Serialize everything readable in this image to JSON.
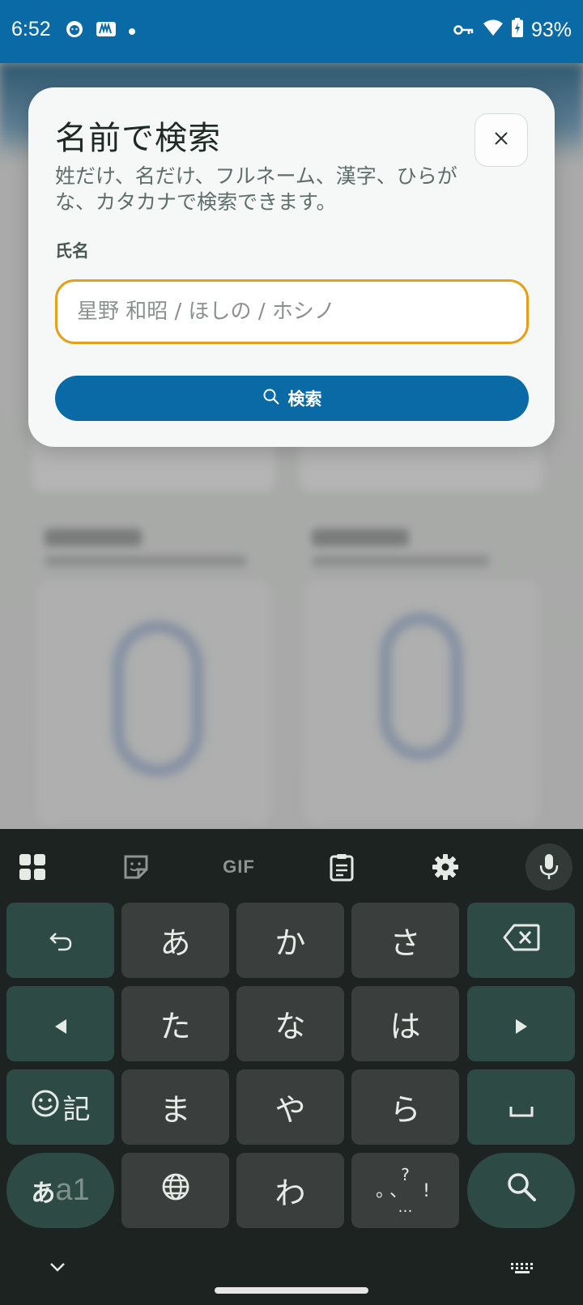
{
  "status_bar": {
    "time": "6:52",
    "battery": "93%",
    "left_icons": [
      "face-notification-icon",
      "news-app-icon",
      "dot-icon"
    ],
    "right_icons": [
      "vpn-key-icon",
      "wifi-icon",
      "battery-icon"
    ]
  },
  "dialog": {
    "title": "名前で検索",
    "description": "姓だけ、名だけ、フルネーム、漢字、ひらがな、カタカナで検索できます。",
    "field_label": "氏名",
    "input_value": "",
    "input_placeholder": "星野 和昭 / ほしの / ホシノ",
    "search_button_label": "検索",
    "accent_color": "#0a6aa5",
    "focus_color": "#e6a015"
  },
  "keyboard": {
    "toolbar": [
      "apps-grid-icon",
      "sticker-icon",
      "gif",
      "clipboard-icon",
      "settings-icon",
      "mic-icon"
    ],
    "gif_label": "GIF",
    "rows": [
      [
        "undo",
        "あ",
        "か",
        "さ",
        "backspace"
      ],
      [
        "left",
        "た",
        "な",
        "は",
        "right"
      ],
      [
        "emoji-symbols",
        "ま",
        "や",
        "ら",
        "space"
      ],
      [
        "mode-switch",
        "globe",
        "わ",
        "punctuation",
        "search"
      ]
    ],
    "emoji_key_label": "記",
    "mode_key_hira": "あ",
    "mode_key_alnum": "a1",
    "punct_top": "?",
    "punct_mid": "。、 !",
    "punct_bottom": "…"
  }
}
